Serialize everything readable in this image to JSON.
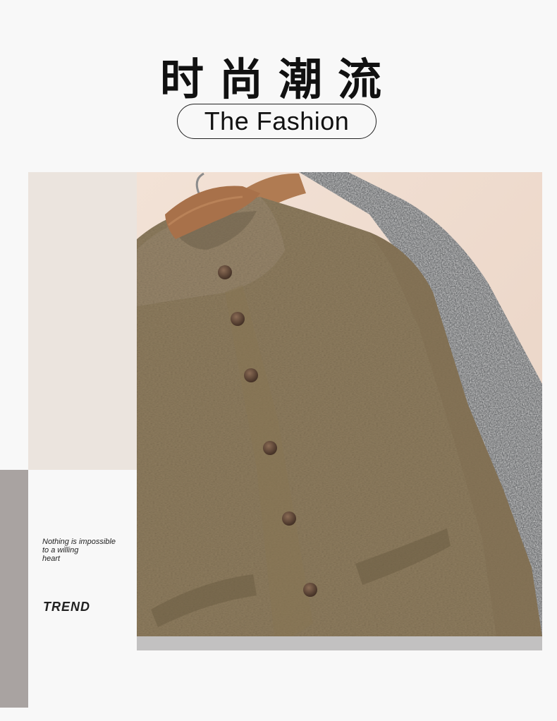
{
  "header": {
    "title_cn": "时尚潮流",
    "subtitle": "The Fashion"
  },
  "sidebar": {
    "quote_lines": [
      "Nothing is impossible",
      "to a willing",
      "heart"
    ],
    "tag": "TREND"
  },
  "colors": {
    "background": "#f8f8f8",
    "beige_panel": "#ebe4de",
    "gray_stripe": "#a9a3a1",
    "bottom_bar": "#c2c1c1",
    "sweater_tan": "#8f7d5f",
    "sweater_dark": "#3e4246",
    "hanger_wood": "#a8714a",
    "button_brown": "#5a4334"
  },
  "image": {
    "subject": "khaki knit stand-collar cardigan and dark grey cardigan on wooden hangers"
  }
}
